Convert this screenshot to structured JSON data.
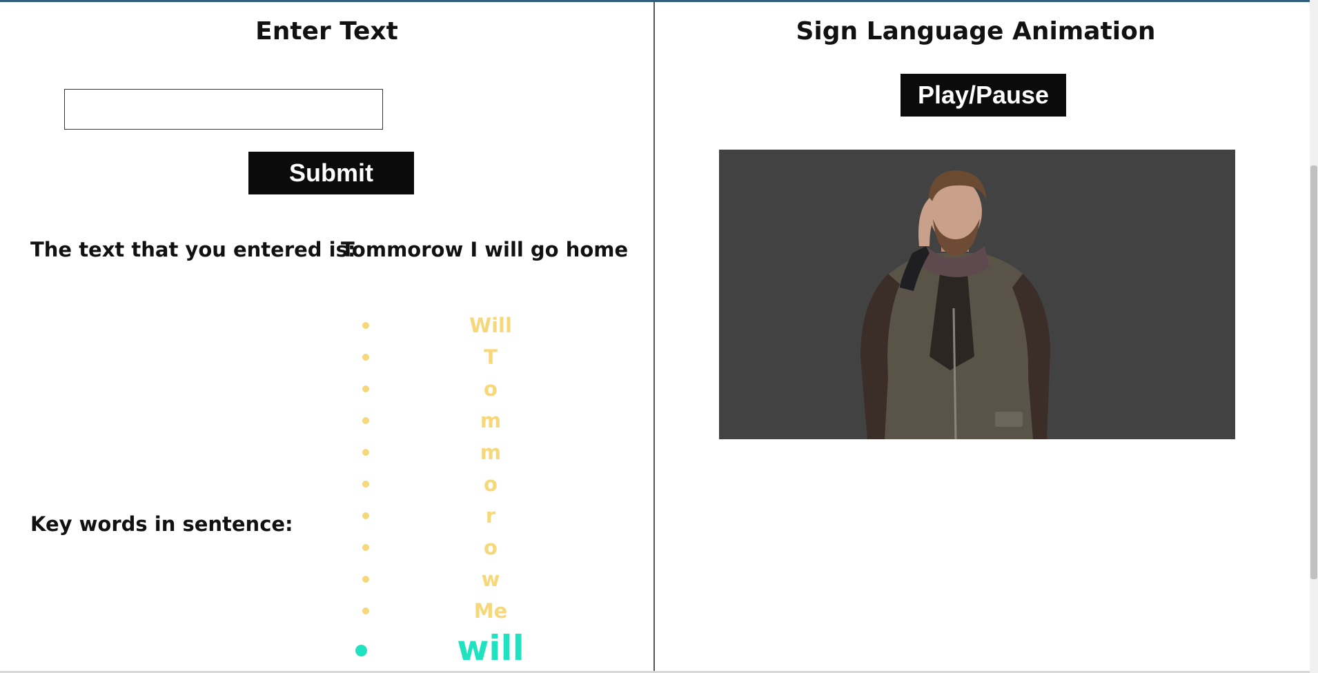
{
  "left_panel": {
    "title": "Enter Text",
    "input_value": "",
    "submit_label": "Submit",
    "entered_label": "The text that you entered is:",
    "entered_value": "Tommorow I will go home",
    "keywords_label": "Key words in sentence:",
    "keywords": [
      "Will",
      "T",
      "o",
      "m",
      "m",
      "o",
      "r",
      "o",
      "w",
      "Me"
    ],
    "active_keyword": "will",
    "colors": {
      "keyword_inactive": "#f6d77a",
      "keyword_active": "#1fe3c0"
    }
  },
  "right_panel": {
    "title": "Sign Language Animation",
    "play_pause_label": "Play/Pause",
    "video_background": "#424242"
  }
}
